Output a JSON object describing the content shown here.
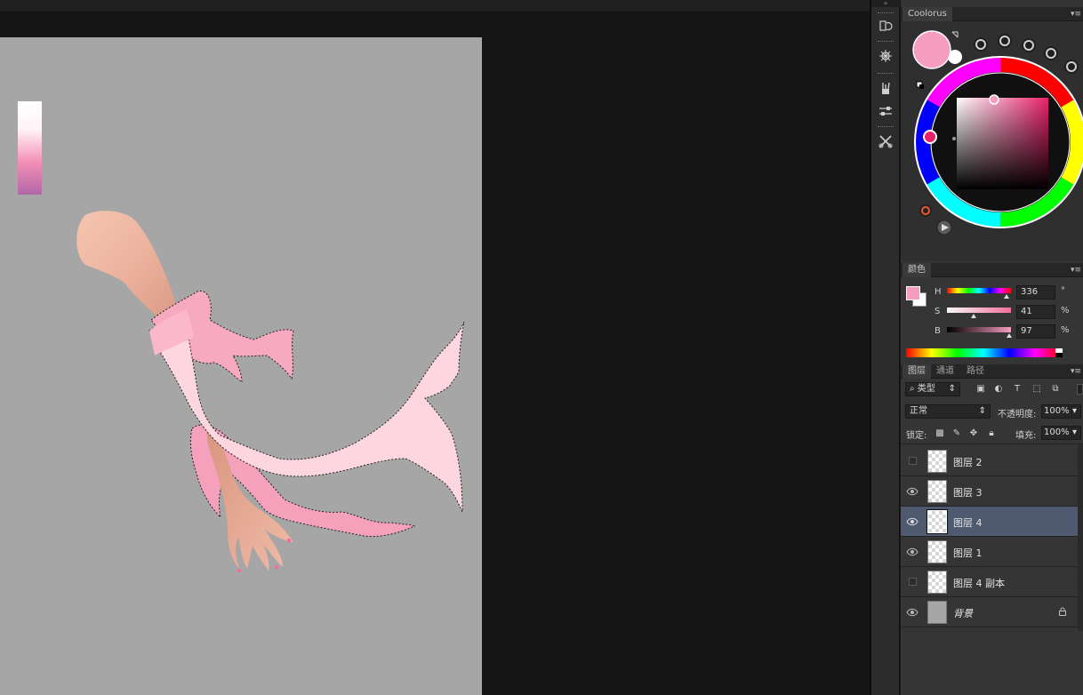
{
  "coolorus": {
    "tab": "Coolorus",
    "foreground": "#f59cbf",
    "background": "#ffffff"
  },
  "color_panel": {
    "tab": "颜色",
    "h": {
      "label": "H",
      "value": "336",
      "unit": "°",
      "level": 0.93
    },
    "s": {
      "label": "S",
      "value": "41",
      "unit": "%",
      "level": 0.41
    },
    "b": {
      "label": "B",
      "value": "97",
      "unit": "%",
      "level": 0.97
    }
  },
  "layers_panel": {
    "tabs": [
      "图层",
      "通道",
      "路径"
    ],
    "filter": "类型",
    "blend_mode": "正常",
    "opacity_label": "不透明度:",
    "opacity_value": "100%",
    "lock_label": "锁定:",
    "fill_label": "填充:",
    "fill_value": "100%",
    "layers": [
      {
        "name": "图层 2",
        "visible": false,
        "selected": false
      },
      {
        "name": "图层 3",
        "visible": true,
        "selected": false
      },
      {
        "name": "图层 4",
        "visible": true,
        "selected": true
      },
      {
        "name": "图层 1",
        "visible": true,
        "selected": false
      },
      {
        "name": "图层 4 副本",
        "visible": false,
        "selected": false
      },
      {
        "name": "背景",
        "visible": true,
        "selected": false,
        "locked": true
      }
    ]
  },
  "colors": {
    "canvas_bg": "#a6a6a6",
    "workspace_bg": "#151515",
    "panel_bg": "#353535",
    "selection_bg": "#4f5a70",
    "sleeve_light": "#fdd6e0",
    "sleeve_mid": "#f7a9c0",
    "skin": "#e9b19a"
  }
}
